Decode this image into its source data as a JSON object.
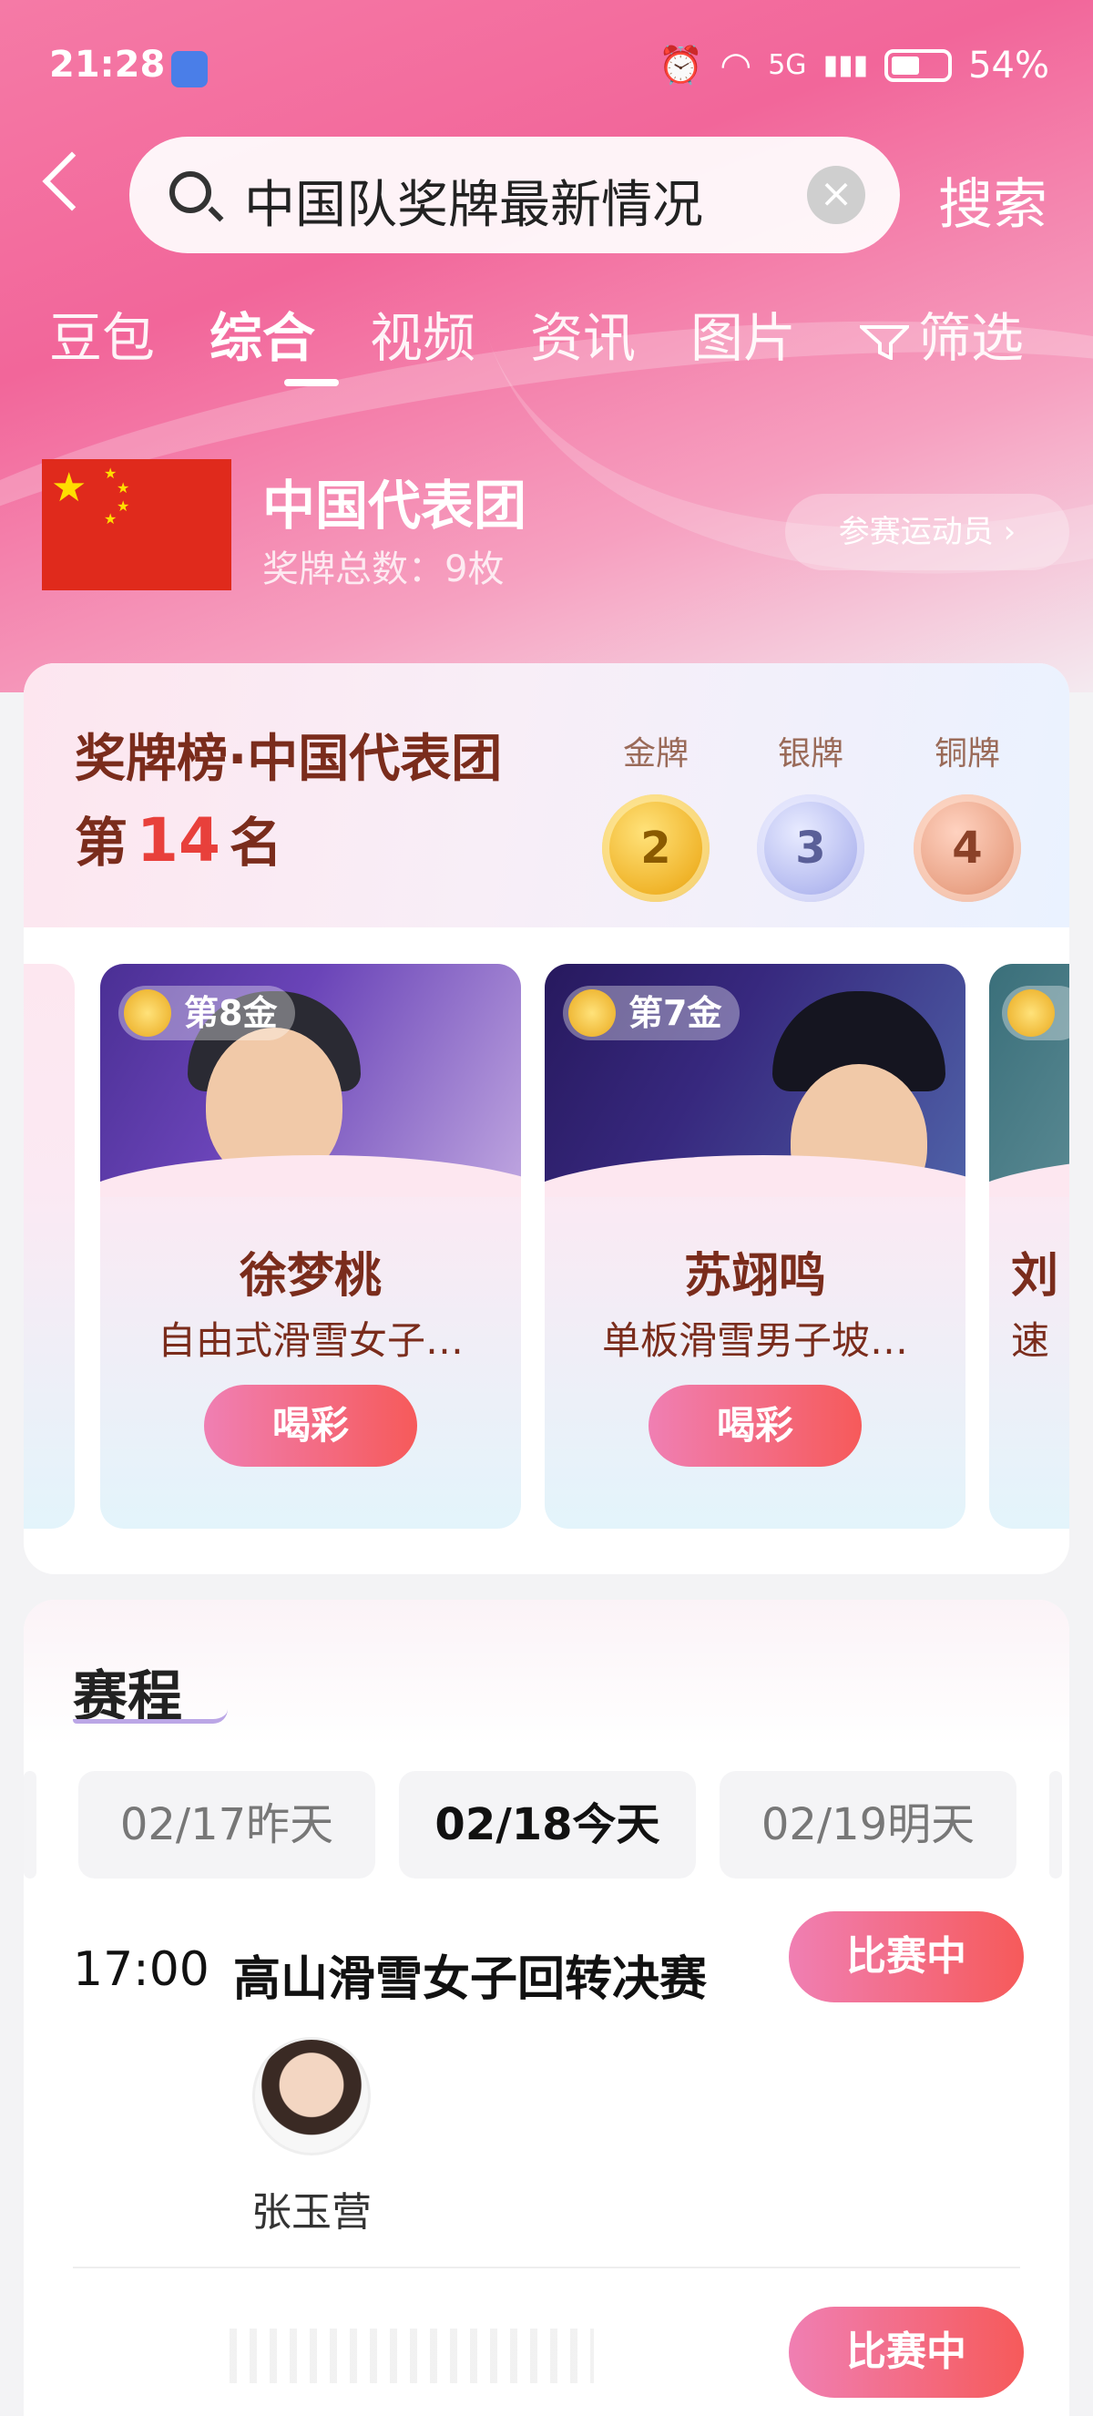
{
  "status": {
    "time": "21:28",
    "network": "5G",
    "battery": "54%"
  },
  "search": {
    "query": "中国队奖牌最新情况",
    "button": "搜索"
  },
  "tabs": [
    "豆包",
    "综合",
    "视频",
    "资讯",
    "图片",
    "筛选"
  ],
  "active_tab": "综合",
  "team": {
    "name": "中国代表团",
    "medal_total": "奖牌总数：9枚",
    "athletes_button": "参赛运动员 ›"
  },
  "medal_table": {
    "title": "奖牌榜·中国代表团",
    "rank_prefix": "第",
    "rank": "14",
    "rank_suffix": "名",
    "gold_label": "金牌",
    "gold": "2",
    "silver_label": "银牌",
    "silver": "3",
    "bronze_label": "铜牌",
    "bronze": "4"
  },
  "winners": [
    {
      "badge": "第8金",
      "name": "徐梦桃",
      "event": "自由式滑雪女子…",
      "cheer": "喝彩"
    },
    {
      "badge": "第7金",
      "name": "苏翊鸣",
      "event": "单板滑雪男子坡…",
      "cheer": "喝彩"
    },
    {
      "name_partial": "刘",
      "event_partial": "速"
    }
  ],
  "schedule": {
    "title": "赛程",
    "dates": [
      "02/17昨天",
      "02/18今天",
      "02/19明天"
    ],
    "active_date": "02/18今天",
    "events": [
      {
        "time": "17:00",
        "title": "高山滑雪女子回转决赛",
        "status": "比赛中",
        "athlete": "张玉营"
      },
      {
        "status": "比赛中"
      }
    ]
  }
}
